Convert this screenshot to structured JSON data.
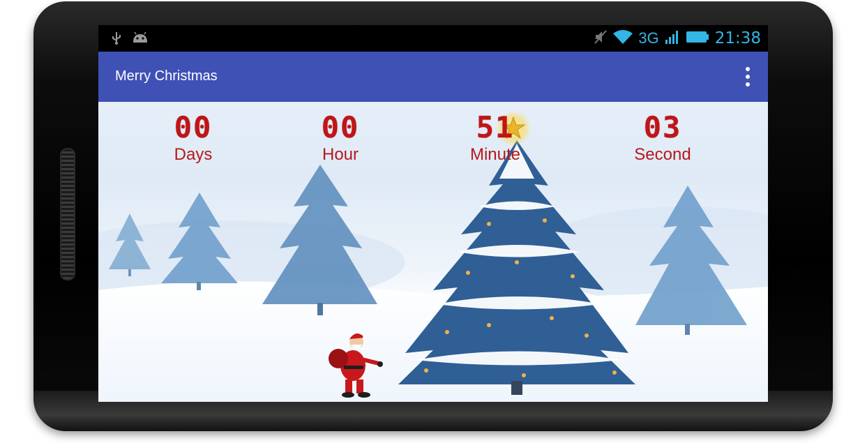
{
  "status_bar": {
    "time": "21:38",
    "network": "3G",
    "icons": [
      "usb-icon",
      "android-icon",
      "mute-icon",
      "wifi-icon",
      "signal-icon",
      "battery-icon"
    ]
  },
  "app_bar": {
    "title": "Merry Christmas",
    "menu_icon": "overflow-menu-icon",
    "color": "#3f51b5"
  },
  "countdown": [
    {
      "value": "00",
      "label": "Days"
    },
    {
      "value": "00",
      "label": "Hour"
    },
    {
      "value": "51",
      "label": "Minute"
    },
    {
      "value": "03",
      "label": "Second"
    }
  ],
  "colors": {
    "accent": "#33b5e5",
    "counter": "#c01518"
  }
}
